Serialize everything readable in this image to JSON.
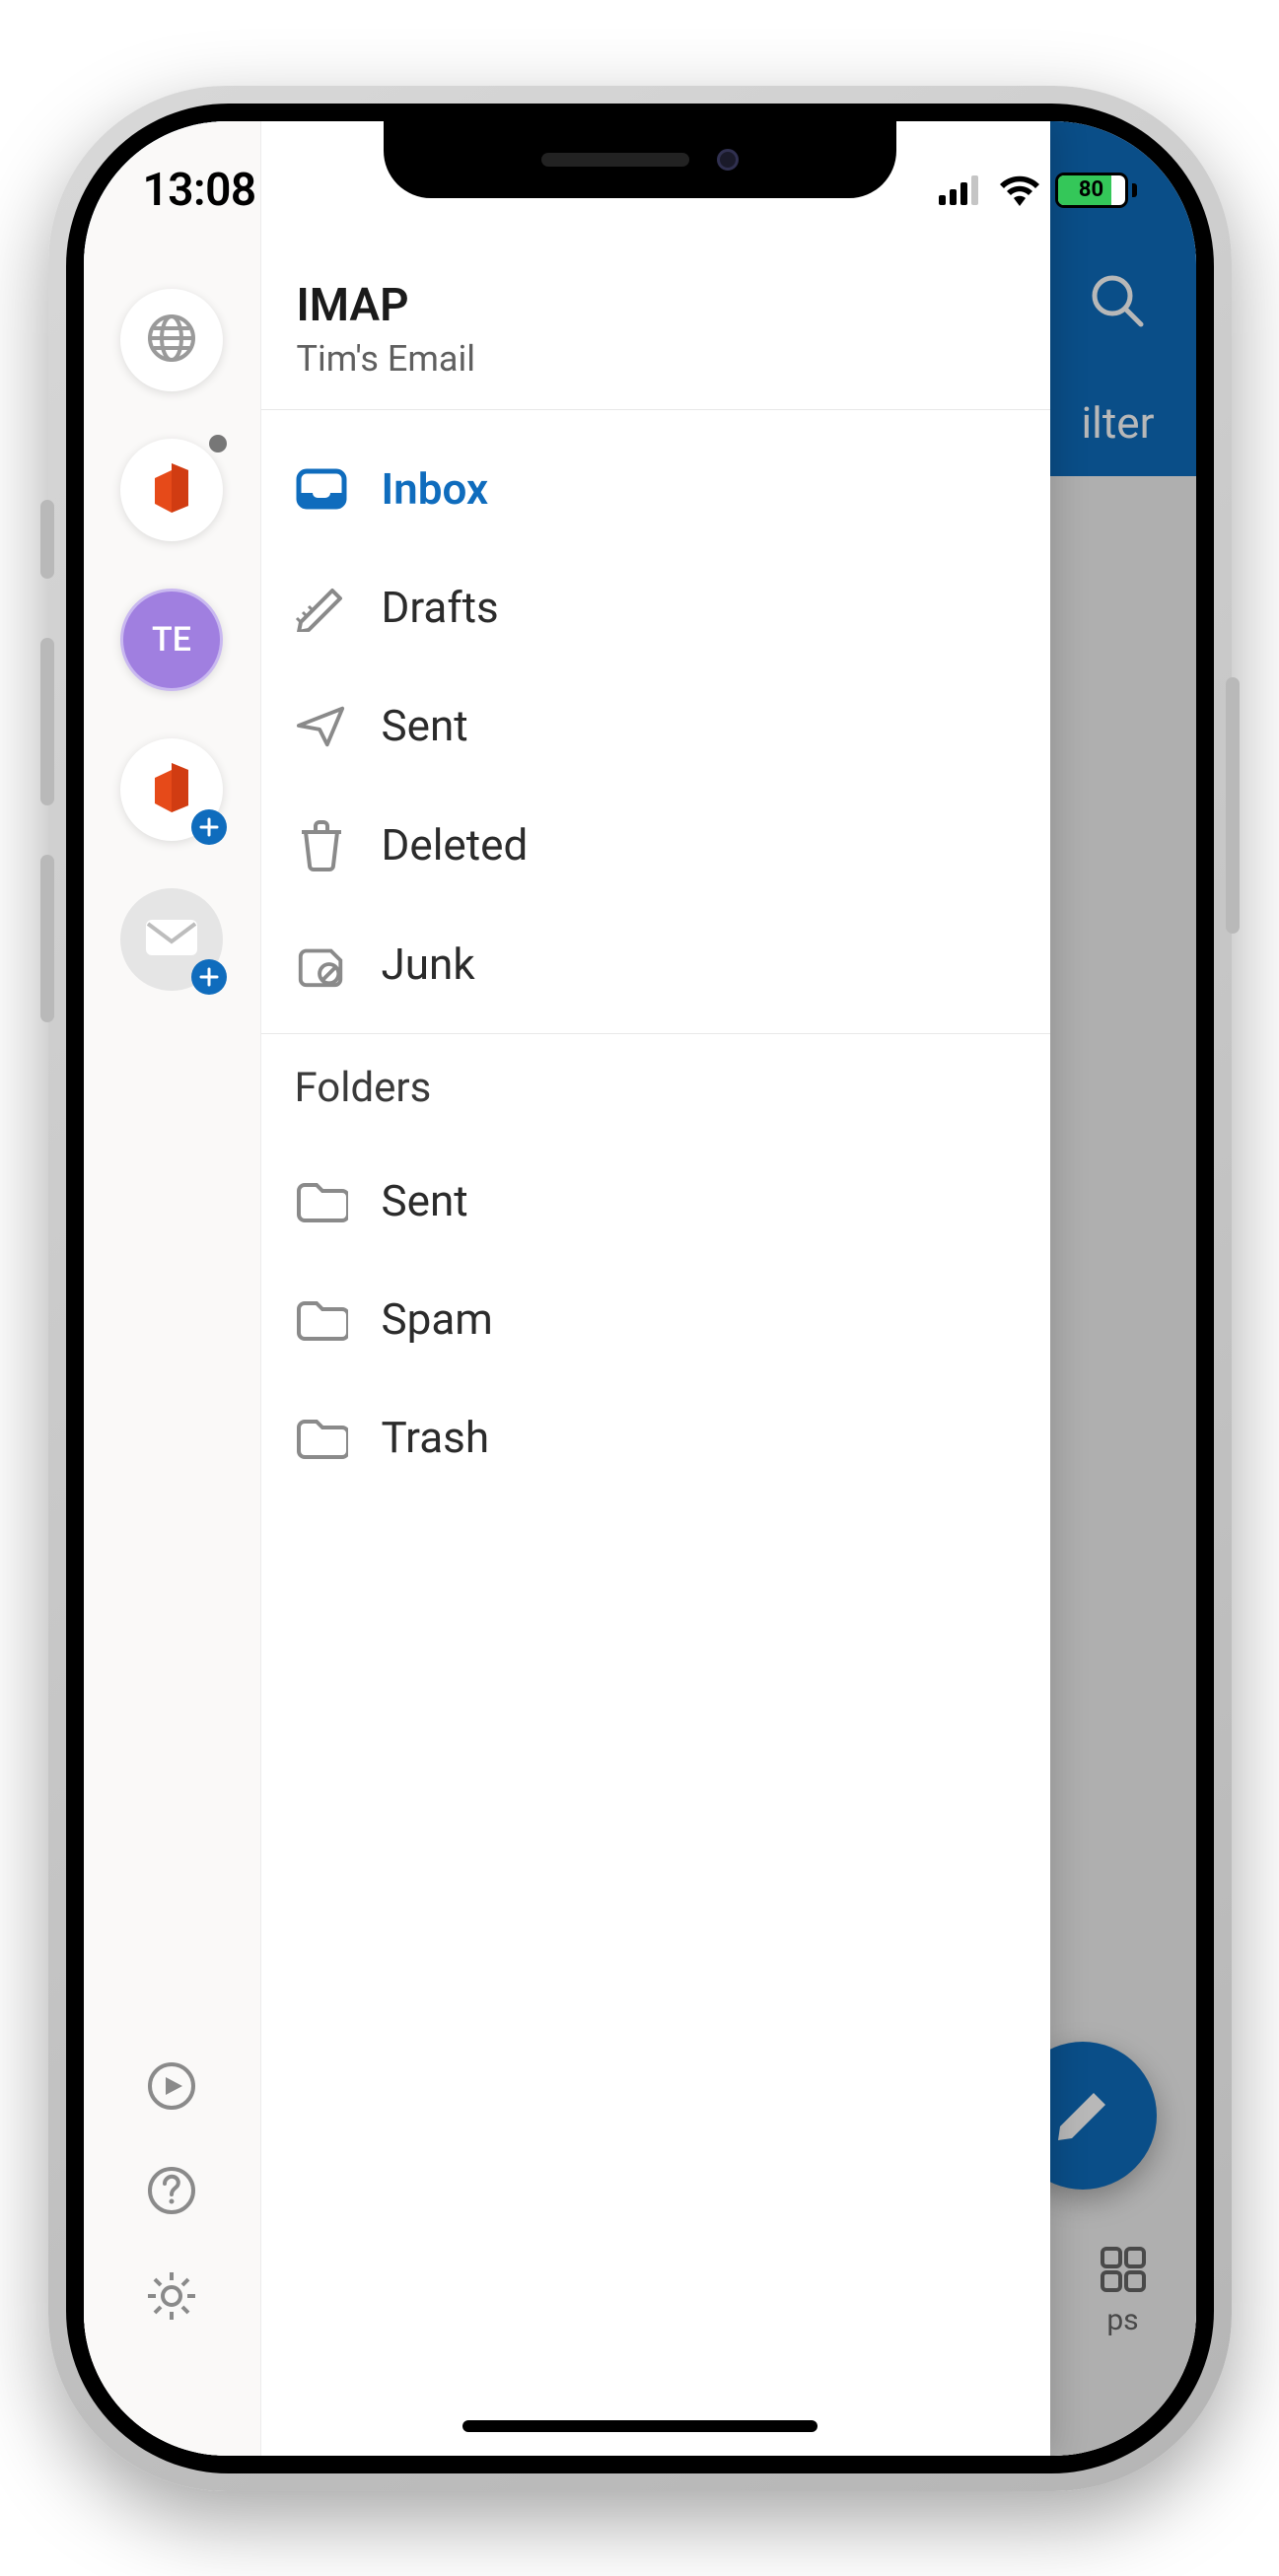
{
  "statusbar": {
    "time": "13:08",
    "battery_percent": "80"
  },
  "background": {
    "filter_label": "ilter",
    "tab_label": "ps"
  },
  "drawer": {
    "account_rail": {
      "selected_initials": "TE"
    },
    "header": {
      "account_type": "IMAP",
      "account_name": "Tim's Email"
    },
    "system_folders": [
      {
        "id": "inbox",
        "label": "Inbox",
        "selected": true
      },
      {
        "id": "drafts",
        "label": "Drafts",
        "selected": false
      },
      {
        "id": "sent",
        "label": "Sent",
        "selected": false
      },
      {
        "id": "deleted",
        "label": "Deleted",
        "selected": false
      },
      {
        "id": "junk",
        "label": "Junk",
        "selected": false
      }
    ],
    "folders_section_label": "Folders",
    "user_folders": [
      {
        "id": "sent2",
        "label": "Sent"
      },
      {
        "id": "spam",
        "label": "Spam"
      },
      {
        "id": "trash",
        "label": "Trash"
      }
    ]
  }
}
